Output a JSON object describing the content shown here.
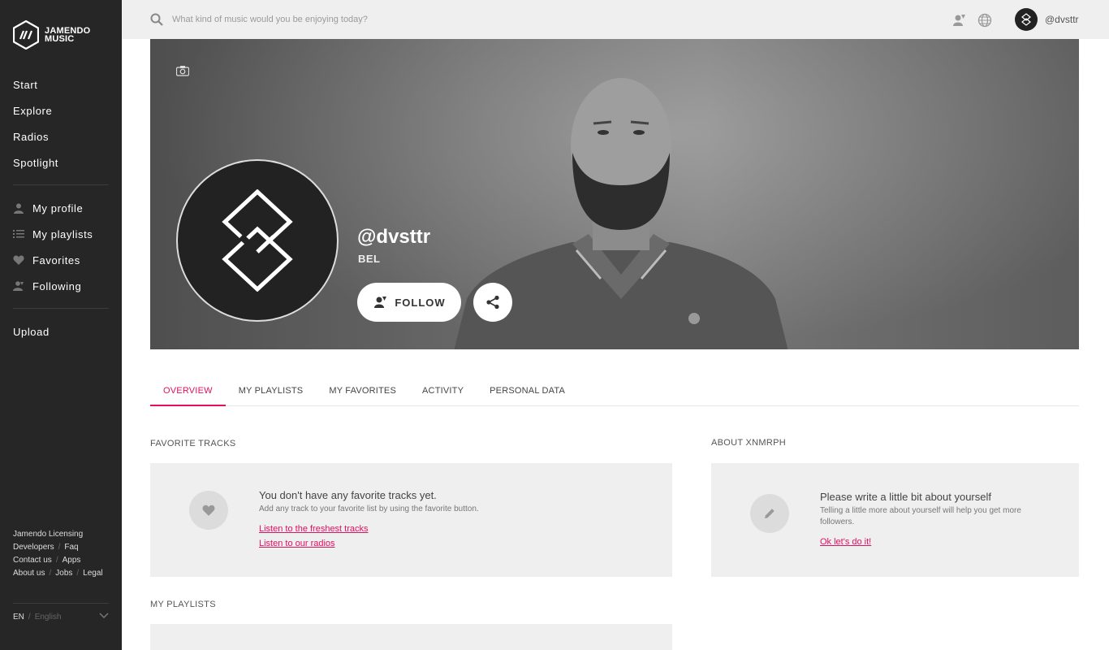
{
  "app": {
    "logo_line1": "JAMENDO",
    "logo_line2": "MUSIC"
  },
  "sidebar": {
    "main_nav": [
      {
        "label": "Start"
      },
      {
        "label": "Explore"
      },
      {
        "label": "Radios"
      },
      {
        "label": "Spotlight"
      }
    ],
    "user_nav": [
      {
        "label": "My profile",
        "icon": "user-icon"
      },
      {
        "label": "My playlists",
        "icon": "playlist-icon"
      },
      {
        "label": "Favorites",
        "icon": "heart-icon"
      },
      {
        "label": "Following",
        "icon": "following-icon"
      }
    ],
    "upload_label": "Upload",
    "footer": {
      "licensing": "Jamendo Licensing",
      "developers": "Developers",
      "faq": "Faq",
      "contact": "Contact us",
      "apps": "Apps",
      "about": "About us",
      "jobs": "Jobs",
      "legal": "Legal"
    },
    "language": {
      "code": "EN",
      "name": "English"
    }
  },
  "topbar": {
    "search_placeholder": "What kind of music would you be enjoying today?",
    "username": "@dvsttr"
  },
  "profile": {
    "handle": "@dvsttr",
    "country": "BEL",
    "follow_label": "FOLLOW"
  },
  "tabs": [
    {
      "label": "OVERVIEW",
      "active": true
    },
    {
      "label": "MY PLAYLISTS",
      "active": false
    },
    {
      "label": "MY FAVORITES",
      "active": false
    },
    {
      "label": "ACTIVITY",
      "active": false
    },
    {
      "label": "PERSONAL DATA",
      "active": false
    }
  ],
  "favorite_tracks": {
    "title": "FAVORITE TRACKS",
    "headline": "You don't have any favorite tracks yet.",
    "sub": "Add any track to your favorite list by using the favorite button.",
    "link1": "Listen to the freshest tracks",
    "link2": "Listen to our radios"
  },
  "about": {
    "title": "ABOUT XNMRPH",
    "headline": "Please write a little bit about yourself",
    "sub": "Telling a little more about yourself will help you get more followers.",
    "link": "Ok let's do it!"
  },
  "my_playlists": {
    "title": "MY PLAYLISTS"
  },
  "colors": {
    "accent": "#e0115f",
    "sidebar_bg": "#262626",
    "topbar_bg": "#efefef",
    "panel_bg": "#efefef"
  }
}
